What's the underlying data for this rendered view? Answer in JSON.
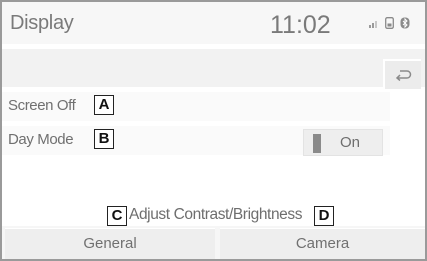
{
  "header": {
    "title": "Display",
    "time": "11:02",
    "status_icons": [
      "signal-bars-icon",
      "phone-icon",
      "bluetooth-icon"
    ]
  },
  "toolbar": {
    "back_icon": "back-arrow-icon"
  },
  "settings": {
    "screen_off": {
      "label": "Screen Off",
      "callout": "A"
    },
    "day_mode": {
      "label": "Day Mode",
      "callout": "B",
      "toggle_label": "On"
    }
  },
  "adjust": {
    "label": "Adjust Contrast/Brightness",
    "callout_left": "C",
    "callout_right": "D"
  },
  "tabs": [
    {
      "label": "General"
    },
    {
      "label": "Camera"
    }
  ],
  "colors": {
    "background": "#ffffff",
    "panel": "#f2f2f2",
    "text": "#6e6e6e",
    "toggle_indicator": "#8a8a8a"
  }
}
